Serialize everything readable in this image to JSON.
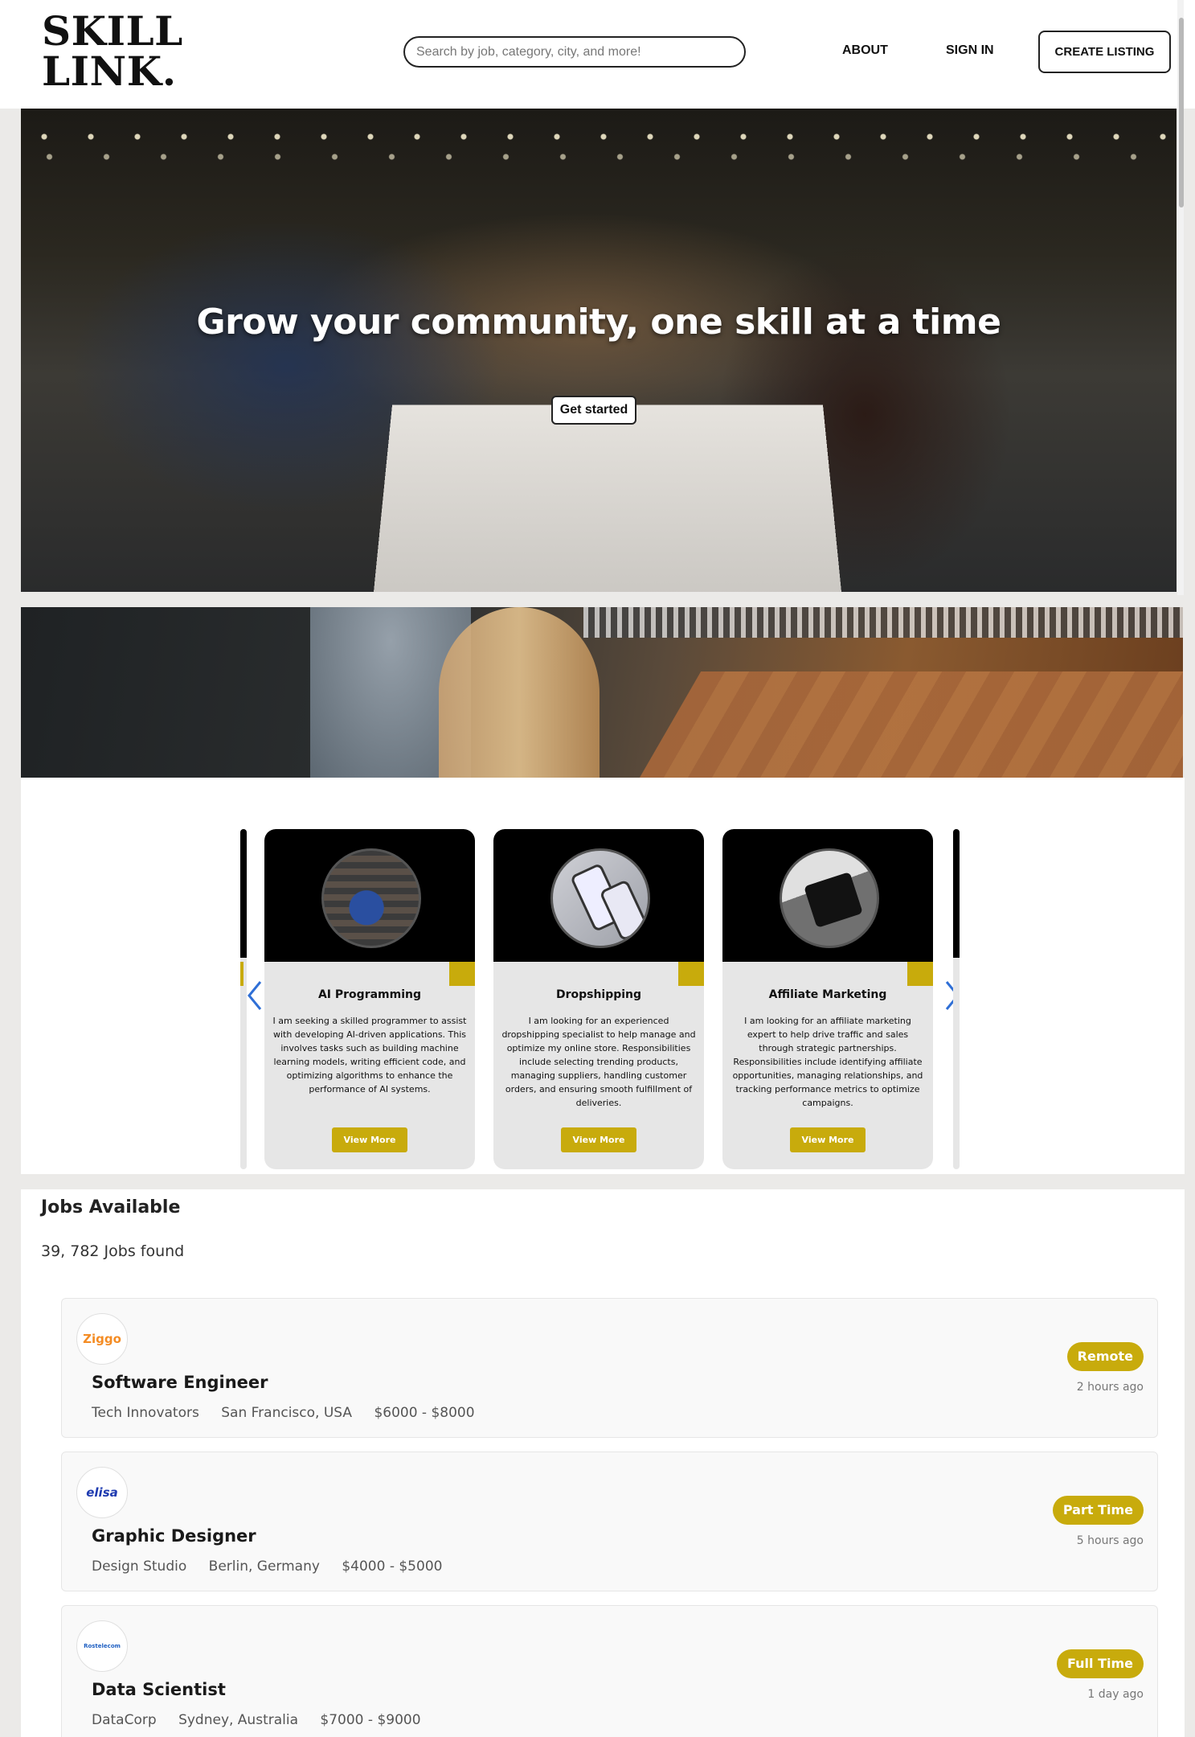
{
  "header": {
    "logo_line1": "SKILL",
    "logo_line2": "LINK.",
    "search_placeholder": "Search by job, category, city, and more!",
    "nav_about": "ABOUT",
    "nav_signin": "SIGN IN",
    "create_listing": "CREATE LISTING"
  },
  "hero": {
    "title": "Grow your community, one skill at a time",
    "cta": "Get started"
  },
  "carousel": {
    "cards": [
      {
        "title": "AI Programming",
        "description": "I am seeking a skilled programmer to assist with developing AI-driven applications. This involves tasks such as building machine learning models, writing efficient code, and optimizing algorithms to enhance the performance of AI systems.",
        "button": "View More"
      },
      {
        "title": "Dropshipping",
        "description": "I am looking for an experienced dropshipping specialist to help manage and optimize my online store. Responsibilities include selecting trending products, managing suppliers, handling customer orders, and ensuring smooth fulfillment of deliveries.",
        "button": "View More"
      },
      {
        "title": "Affiliate Marketing",
        "description": "I am looking for an affiliate marketing expert to help drive traffic and sales through strategic partnerships. Responsibilities include identifying affiliate opportunities, managing relationships, and tracking performance metrics to optimize campaigns.",
        "button": "View More"
      }
    ]
  },
  "jobs": {
    "title": "Jobs Available",
    "count": "39, 782 Jobs found",
    "items": [
      {
        "logo": "Ziggo",
        "title": "Software Engineer",
        "company": "Tech Innovators",
        "location": "San Francisco, USA",
        "salary": "$6000 - $8000",
        "type": "Remote",
        "posted": "2 hours ago"
      },
      {
        "logo": "elisa",
        "title": "Graphic Designer",
        "company": "Design Studio",
        "location": "Berlin, Germany",
        "salary": "$4000 - $5000",
        "type": "Part Time",
        "posted": "5 hours ago"
      },
      {
        "logo": "Rostelecom",
        "title": "Data Scientist",
        "company": "DataCorp",
        "location": "Sydney, Australia",
        "salary": "$7000 - $9000",
        "type": "Full Time",
        "posted": "1 day ago"
      }
    ]
  },
  "colors": {
    "accent_gold": "#c8ab0c",
    "arrow_blue": "#2f6fd6",
    "ziggo_orange": "#f48c24",
    "elisa_blue": "#1f3bb0"
  },
  "icons": {
    "prev": "chevron-left-icon",
    "next": "chevron-right-icon"
  }
}
